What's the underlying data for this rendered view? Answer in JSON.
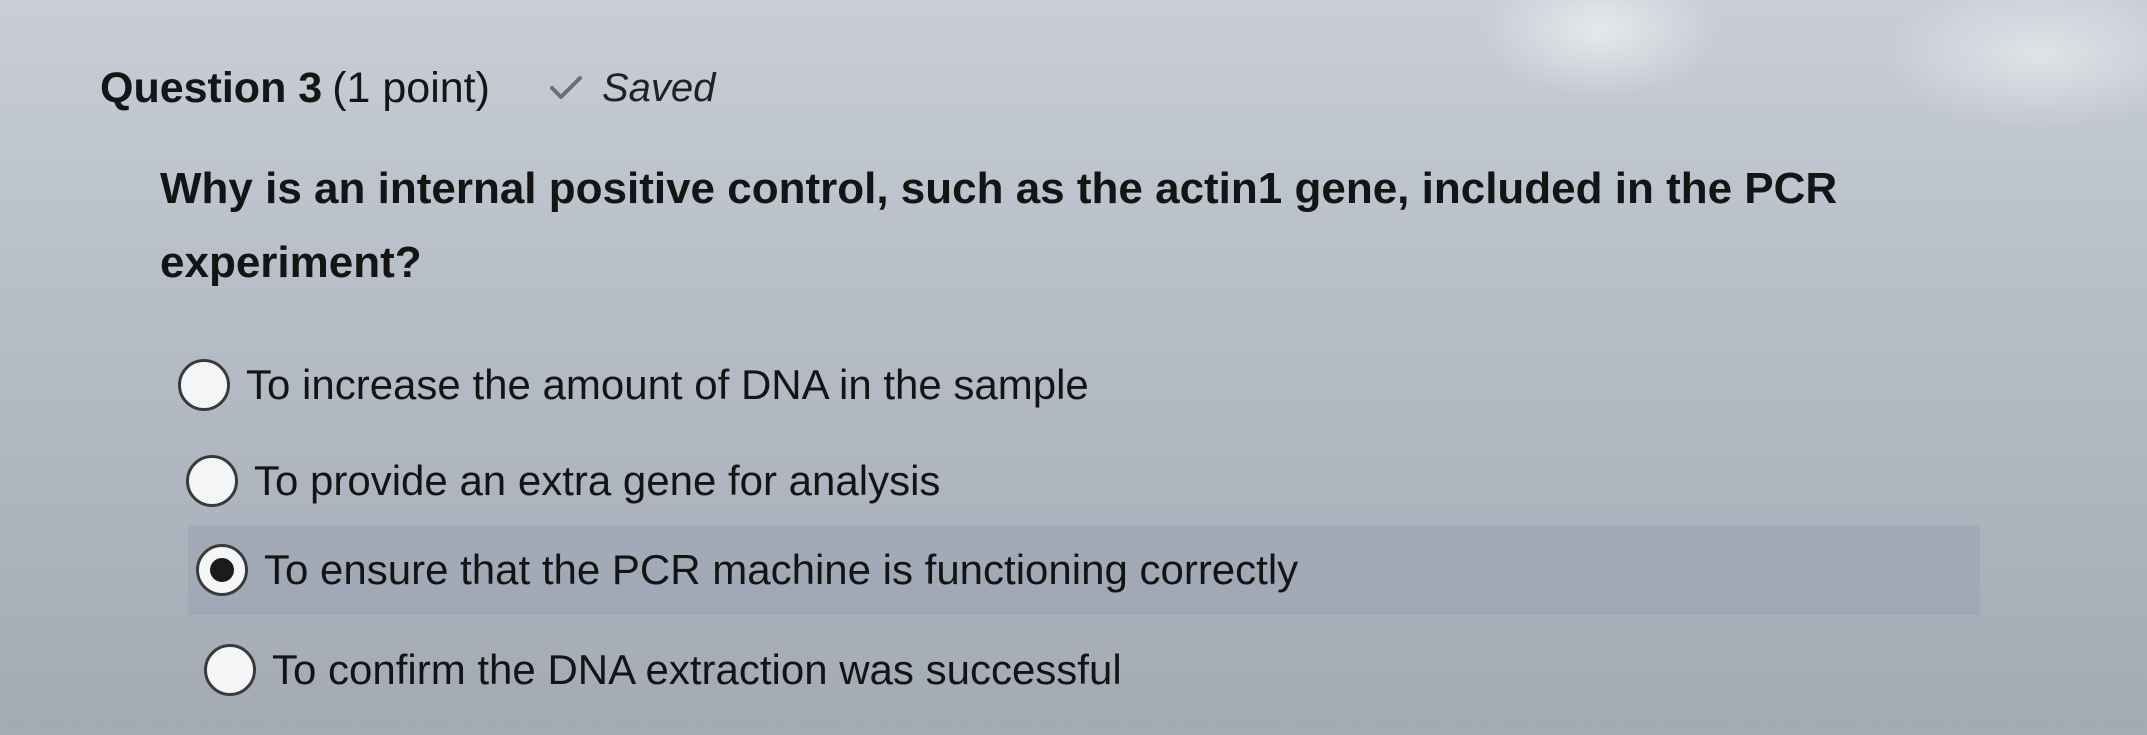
{
  "question": {
    "title": "Question 3",
    "points": "(1 point)",
    "status_icon": "check-icon",
    "status_text": "Saved",
    "text": "Why is an internal positive control, such as the actin1 gene, included in the PCR experiment?"
  },
  "options": [
    {
      "label": "To increase the amount of DNA in the sample",
      "selected": false
    },
    {
      "label": "To provide an extra gene for analysis",
      "selected": false
    },
    {
      "label": "To ensure that the PCR machine is functioning correctly",
      "selected": true
    },
    {
      "label": "To confirm the DNA extraction was successful",
      "selected": false
    }
  ],
  "colors": {
    "selected_row": "#a7afbf",
    "text": "#141414"
  }
}
